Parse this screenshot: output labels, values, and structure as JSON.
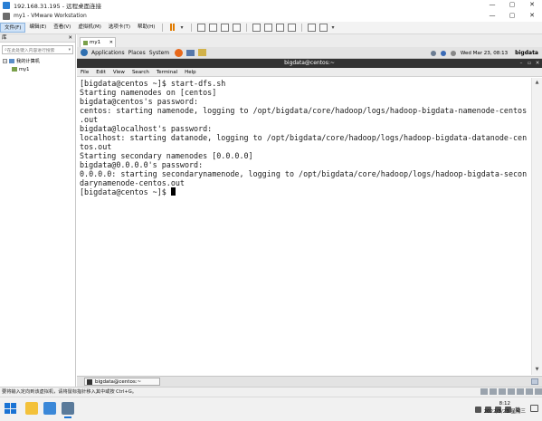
{
  "rdp": {
    "title": "192.168.31.195 - 远程桌面连接",
    "controls": [
      "—",
      "▢",
      "✕"
    ]
  },
  "vmware": {
    "title": "my1 - VMware Workstation",
    "controls": [
      "—",
      "▢",
      "✕"
    ],
    "menu": [
      "文件(F)",
      "编辑(E)",
      "查看(V)",
      "虚拟机(M)",
      "选项卡(T)",
      "帮助(H)"
    ]
  },
  "library": {
    "header": "库",
    "close": "✕",
    "search_placeholder": "在此处键入内容进行搜索",
    "tree": {
      "root": "我的计算机",
      "child": "my1"
    }
  },
  "tab": {
    "label": "my1",
    "close": "✕"
  },
  "gnome_panel": {
    "applications": "Applications",
    "places": "Places",
    "system": "System",
    "datetime": "Wed Mar 23, 08:13",
    "user": "bigdata"
  },
  "terminal": {
    "title": "bigdata@centos:~",
    "controls": [
      "–",
      "▫",
      "✕"
    ],
    "menu": [
      "File",
      "Edit",
      "View",
      "Search",
      "Terminal",
      "Help"
    ],
    "lines": [
      "[bigdata@centos ~]$ start-dfs.sh",
      "Starting namenodes on [centos]",
      "bigdata@centos's password:",
      "centos: starting namenode, logging to /opt/bigdata/core/hadoop/logs/hadoop-bigdata-namenode-centos",
      ".out",
      "bigdata@localhost's password:",
      "localhost: starting datanode, logging to /opt/bigdata/core/hadoop/logs/hadoop-bigdata-datanode-cen",
      "tos.out",
      "Starting secondary namenodes [0.0.0.0]",
      "bigdata@0.0.0.0's password:",
      "0.0.0.0: starting secondarynamenode, logging to /opt/bigdata/core/hadoop/logs/hadoop-bigdata-secon",
      "darynamenode-centos.out"
    ],
    "prompt": "[bigdata@centos ~]$ "
  },
  "gnome_bottom": {
    "task_label": "bigdata@centos:~"
  },
  "status_bar": {
    "text": "要将输入定向到该虚拟机，请将鼠标指针移入其中或按 Ctrl+G。"
  },
  "taskbar": {
    "tray_label": "英",
    "time": "8:12",
    "date": "2022/3/23 星期三"
  },
  "colors": {
    "terminal_titlebar": "#333333",
    "accent": "#1a73d4",
    "pause": "#e07b00"
  }
}
